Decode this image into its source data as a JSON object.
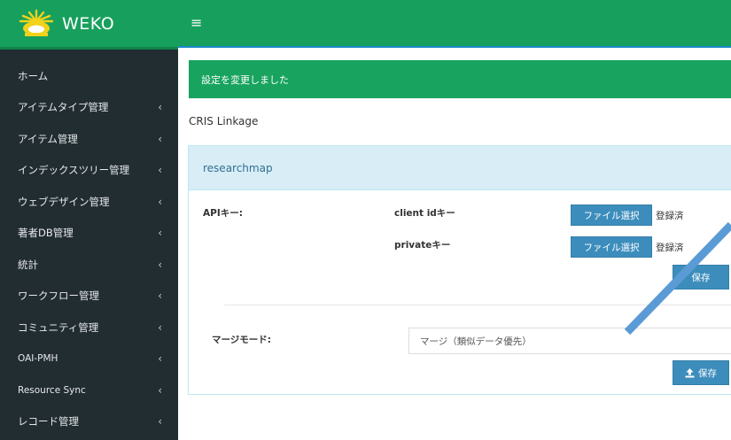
{
  "brand": {
    "name": "WEKO"
  },
  "topbar": {
    "menu_glyph": "≡"
  },
  "sidebar": {
    "items": [
      {
        "label": "ホーム",
        "chevron": ""
      },
      {
        "label": "アイテムタイプ管理",
        "chevron": "‹"
      },
      {
        "label": "アイテム管理",
        "chevron": "‹"
      },
      {
        "label": "インデックスツリー管理",
        "chevron": "‹"
      },
      {
        "label": "ウェブデザイン管理",
        "chevron": "‹"
      },
      {
        "label": "著者DB管理",
        "chevron": "‹"
      },
      {
        "label": "統計",
        "chevron": "‹"
      },
      {
        "label": "ワークフロー管理",
        "chevron": "‹"
      },
      {
        "label": "コミュニティ管理",
        "chevron": "‹"
      },
      {
        "label": "OAI-PMH",
        "chevron": "‹"
      },
      {
        "label": "Resource Sync",
        "chevron": "‹"
      },
      {
        "label": "レコード管理",
        "chevron": "‹"
      }
    ]
  },
  "main": {
    "alert": "設定を変更しました",
    "section_title": "CRIS Linkage",
    "panel": {
      "heading": "researchmap",
      "api_key_label": "APIキー:",
      "client_id_label": "client idキー",
      "private_key_label": "privateキー",
      "file_select_label": "ファイル選択",
      "registered_label": "登録済",
      "save_label": "保存",
      "merge_mode_label": "マージモード:",
      "merge_mode_value": "マージ（類似データ優先）"
    }
  },
  "colors": {
    "brand_green": "#17a05d",
    "sidebar_dark": "#222d32",
    "button_blue": "#3c8dbc",
    "panel_head": "#d9edf7",
    "annotation_arrow": "#5b9bd5"
  }
}
